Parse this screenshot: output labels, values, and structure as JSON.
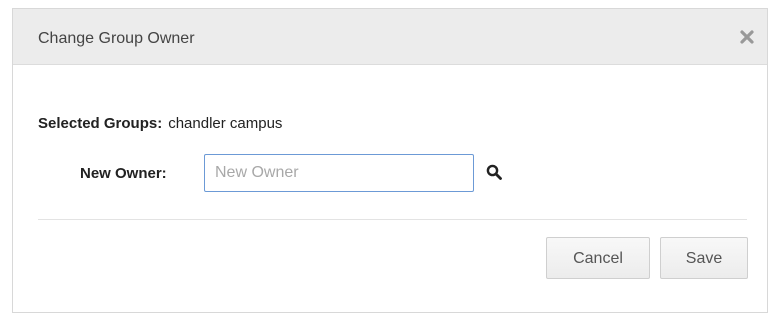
{
  "dialog": {
    "title": "Change Group Owner",
    "close_icon": "close-icon"
  },
  "selected_groups": {
    "label": "Selected Groups:",
    "value": "chandler campus"
  },
  "new_owner": {
    "label": "New Owner:",
    "placeholder": "New Owner",
    "value": "",
    "search_icon": "search-icon"
  },
  "buttons": {
    "cancel_label": "Cancel",
    "save_label": "Save"
  },
  "colors": {
    "titlebar_bg": "#ececec",
    "input_focus_border": "#6c9ad6"
  }
}
